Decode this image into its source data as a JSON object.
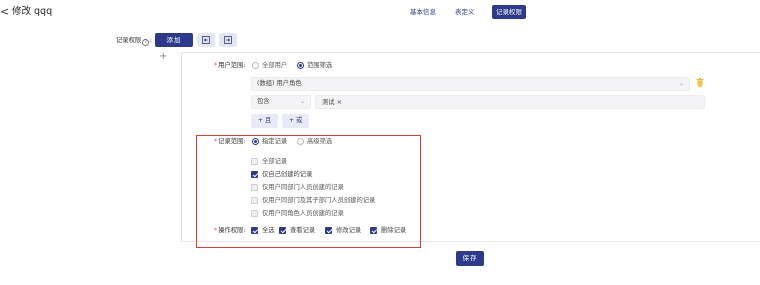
{
  "header": {
    "back_glyph": "<",
    "title": "修改 qqq",
    "tabs": [
      {
        "label": "基本信息",
        "active": false
      },
      {
        "label": "表定义",
        "active": false
      },
      {
        "label": "记录权限",
        "active": true
      }
    ]
  },
  "permission_bar": {
    "label": "记录权限",
    "help_glyph": "?",
    "add_label": "添加"
  },
  "rule": {
    "plus_glyph": "+",
    "user_scope": {
      "label": "用户范围:",
      "options": [
        {
          "label": "全部用户",
          "selected": false
        },
        {
          "label": "范围筛选",
          "selected": true
        }
      ],
      "field_select": "(数组) 用户角色",
      "operator_select": "包含",
      "tag_value": "测试 ×",
      "and_label": "+ 且",
      "or_label": "+ 或"
    },
    "record_scope": {
      "label": "记录范围:",
      "options": [
        {
          "label": "指定记录",
          "selected": true
        },
        {
          "label": "高级筛选",
          "selected": false
        }
      ],
      "checkboxes": [
        {
          "label": "全部记录",
          "checked": false
        },
        {
          "label": "仅自己创建的记录",
          "checked": true
        },
        {
          "label": "仅用户同部门人员创建的记录",
          "checked": false
        },
        {
          "label": "仅用户同部门及其子部门人员创建的记录",
          "checked": false
        },
        {
          "label": "仅用户同角色人员创建的记录",
          "checked": false
        }
      ]
    },
    "operations": {
      "label": "操作权限:",
      "items": [
        {
          "label": "全选",
          "checked": true
        },
        {
          "label": "查看记录",
          "checked": true
        },
        {
          "label": "修改记录",
          "checked": true
        },
        {
          "label": "删除记录",
          "checked": true
        }
      ]
    }
  },
  "footer": {
    "save_label": "保存"
  },
  "colors": {
    "primary": "#2d3a8c",
    "highlight": "#e23b3b",
    "required": "#e24a4a"
  }
}
